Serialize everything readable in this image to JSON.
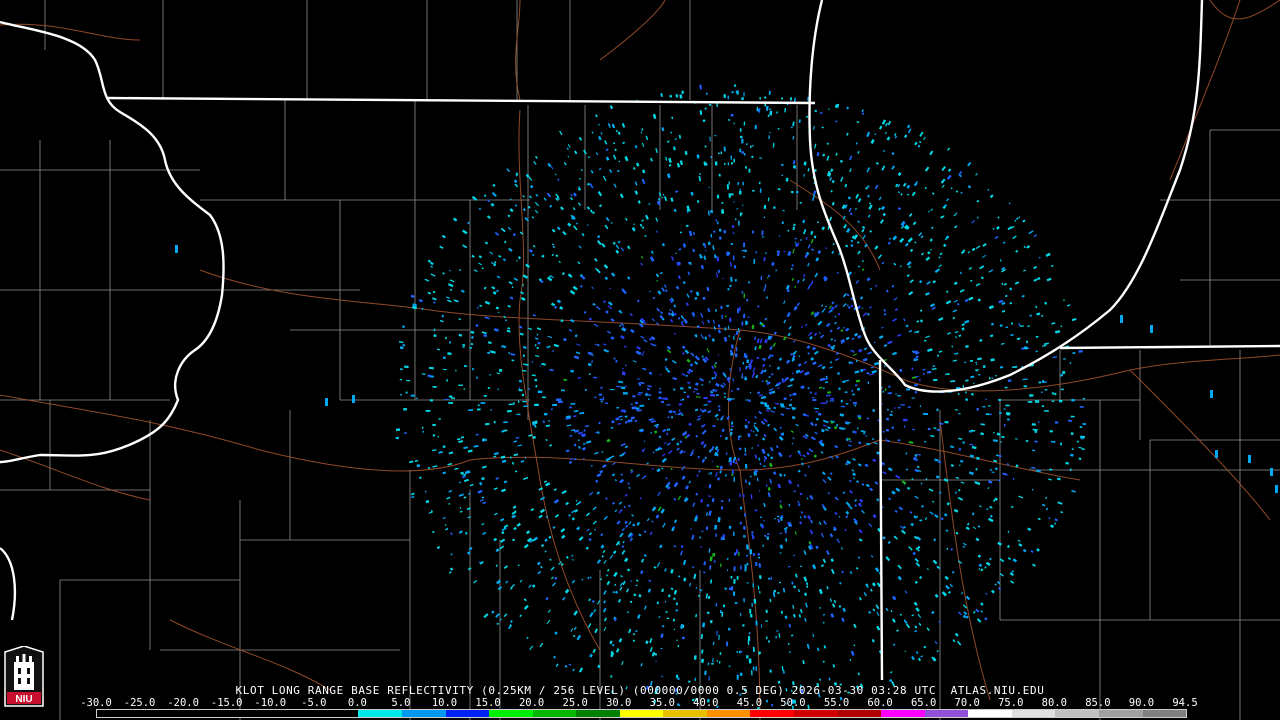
{
  "product": {
    "caption": "KLOT LONG RANGE BASE REFLECTIVITY (0.25KM / 256 LEVEL) (000000/0000 0.5 DEG) 2026-03-30 03:28 UTC  ATLAS.NIU.EDU",
    "logo_text": "NIU"
  },
  "colorbar": {
    "ticks": [
      "-30.0",
      "-25.0",
      "-20.0",
      "-15.0",
      "-10.0",
      "-5.0",
      "0.0",
      "5.0",
      "10.0",
      "15.0",
      "20.0",
      "25.0",
      "30.0",
      "35.0",
      "40.0",
      "45.0",
      "50.0",
      "55.0",
      "60.0",
      "65.0",
      "70.0",
      "75.0",
      "80.0",
      "85.0",
      "90.0",
      "94.5"
    ],
    "colors": [
      "#000000",
      "#000000",
      "#000000",
      "#000000",
      "#000000",
      "#000000",
      "#00e8e8",
      "#0098f0",
      "#0020f8",
      "#00f000",
      "#00b800",
      "#008000",
      "#ffff00",
      "#e8c000",
      "#ff9000",
      "#ff0000",
      "#d00000",
      "#b00000",
      "#ff00ff",
      "#9050d8",
      "#ffffff",
      "#e0e0e0",
      "#c0c0c0",
      "#a0a0a0",
      "#808080"
    ]
  },
  "map": {
    "radar_site": "KLOT",
    "boundary_color": "#ffffff",
    "county_color": "#9a9a9a",
    "road_color": "#a0522d",
    "echo_colors": [
      "#00d8e8",
      "#00a8f0",
      "#1e64ff",
      "#2a3cf0",
      "#18b418"
    ]
  }
}
